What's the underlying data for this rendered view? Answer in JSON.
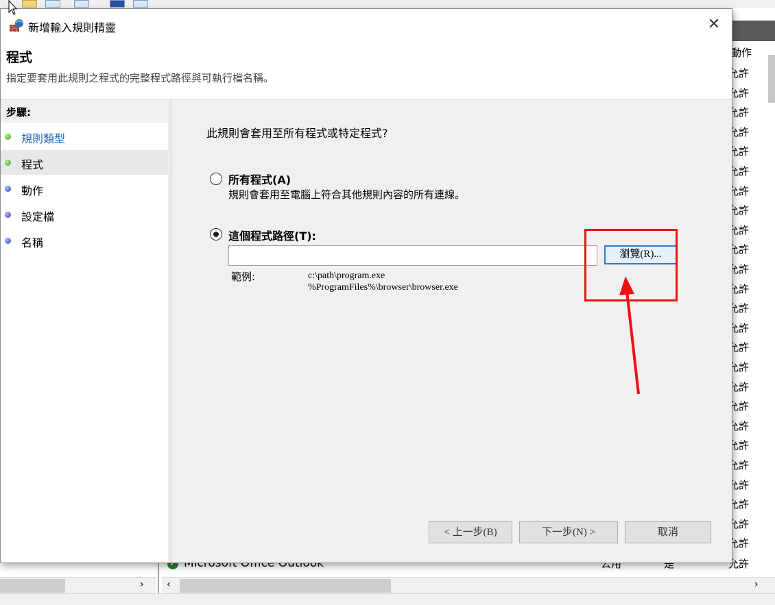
{
  "dialog": {
    "title": "新增輸入規則精靈",
    "close_glyph": "✕",
    "page_title": "程式",
    "page_description": "指定要套用此規則之程式的完整程式路徑與可執行檔名稱。"
  },
  "steps": {
    "title": "步驟:",
    "items": [
      {
        "label": "規則類型",
        "status": "done"
      },
      {
        "label": "程式",
        "status": "current"
      },
      {
        "label": "動作",
        "status": "pending"
      },
      {
        "label": "設定檔",
        "status": "pending"
      },
      {
        "label": "名稱",
        "status": "pending"
      }
    ]
  },
  "content": {
    "question": "此規則會套用至所有程式或特定程式?",
    "option_all": {
      "label": "所有程式(A)",
      "description": "規則會套用至電腦上符合其他規則內容的所有連線。",
      "selected": false
    },
    "option_path": {
      "label": "這個程式路徑(T):",
      "selected": true
    },
    "path_input_value": "",
    "browse_label": "瀏覽(R)...",
    "example_label": "範例:",
    "example_1": "c:\\path\\program.exe",
    "example_2": "%ProgramFiles%\\browser\\browser.exe"
  },
  "buttons": {
    "back": "< 上一步(B)",
    "next": "下一步(N) >",
    "cancel": "取消"
  },
  "background": {
    "column_title": "動作",
    "allow_text": "允許",
    "row": {
      "name": "Microsoft Office Outlook",
      "profile": "公用",
      "enabled": "是",
      "action": "允許"
    },
    "scroll_left": "‹",
    "scroll_right": "›"
  },
  "colors": {
    "annotation": "#ee1111",
    "link": "#1a5fb4",
    "browse_border": "#2b79d6"
  }
}
